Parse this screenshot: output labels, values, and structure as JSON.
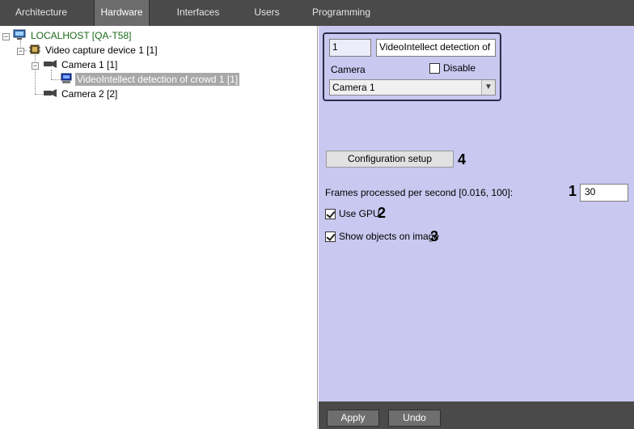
{
  "tabs": [
    {
      "label": "Architecture",
      "active": false
    },
    {
      "label": "Hardware",
      "active": true
    },
    {
      "label": "Interfaces",
      "active": false
    },
    {
      "label": "Users",
      "active": false
    },
    {
      "label": "Programming",
      "active": false
    }
  ],
  "tree": {
    "root": "LOCALHOST [QA-T58]",
    "device": "Video capture device 1 [1]",
    "camera1": "Camera 1 [1]",
    "detector": "VideoIntellect detection of crowd 1 [1]",
    "camera2": "Camera 2 [2]"
  },
  "header": {
    "id_value": "1",
    "name_value": "VideoIntellect detection of cro",
    "camera_label": "Camera",
    "disable_label": "Disable",
    "disable_checked": false,
    "camera_selected": "Camera 1"
  },
  "settings": {
    "config_button": "Configuration setup",
    "fps_label": "Frames processed per second [0.016, 100]:",
    "fps_value": "30",
    "use_gpu_label": "Use GPU",
    "use_gpu_checked": true,
    "show_objects_label": "Show objects on image",
    "show_objects_checked": true
  },
  "callouts": {
    "fps": "1",
    "gpu": "2",
    "show": "3",
    "config": "4"
  },
  "footer": {
    "apply": "Apply",
    "undo": "Undo"
  },
  "colors": {
    "tab_bar": "#4a4a4a",
    "panel_bg": "#c8c8f0",
    "root_text": "#1a6b1a",
    "selected_bg": "#a8a8a8"
  },
  "icons": {
    "root": "computer-icon",
    "device": "chip-icon",
    "camera": "camera-icon",
    "detector": "monitor-icon"
  }
}
